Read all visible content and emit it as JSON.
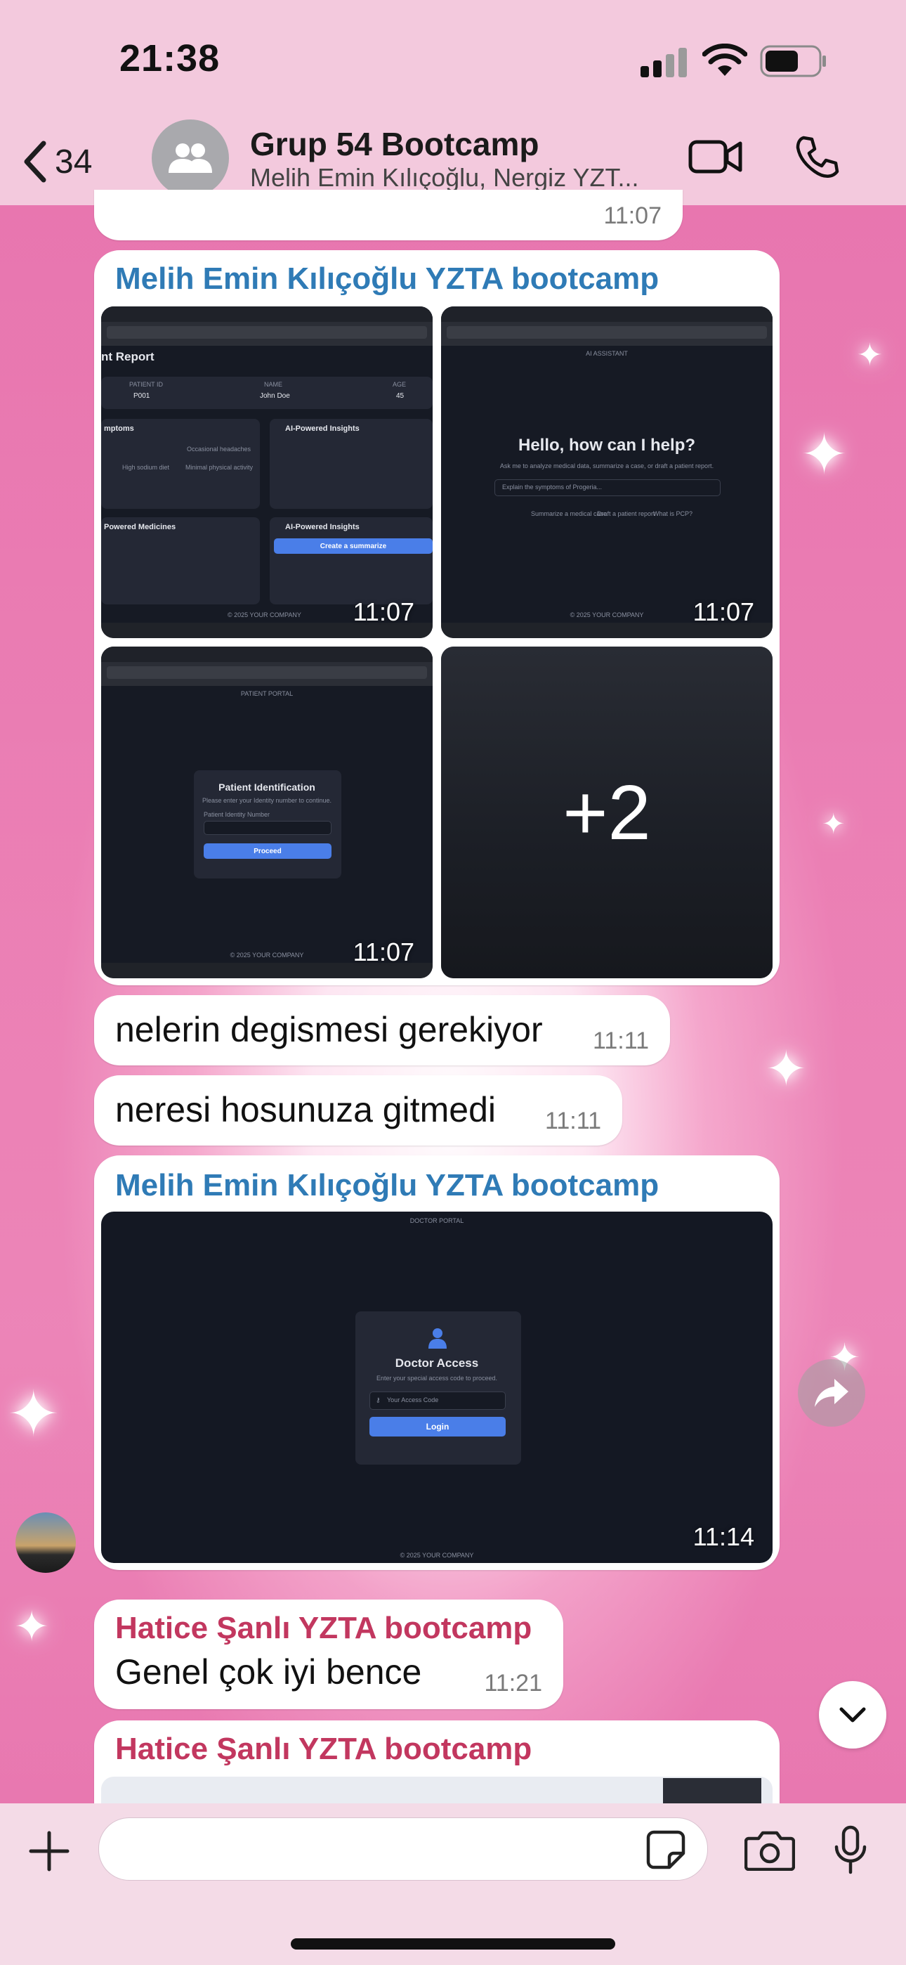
{
  "status_bar": {
    "time": "21:38"
  },
  "header": {
    "back_count": "34",
    "title": "Grup 54 Bootcamp",
    "subtitle": "Melih Emin Kılıçoğlu, Nergiz YZT..."
  },
  "messages": [
    {
      "time": "11:07"
    },
    {
      "sender": "Melih Emin Kılıçoğlu YZTA bootcamp",
      "sender_color": "#2f7bb6",
      "album": [
        {
          "time": "11:07",
          "title": "nt Report",
          "labels": [
            "PATIENT ID",
            "NAME",
            "AGE"
          ],
          "values": [
            "P001",
            "John Doe",
            "45"
          ],
          "sections": [
            "mptoms",
            "AI-Powered Insights",
            "Powered Medicines",
            "AI-Powered Insights"
          ],
          "tags": [
            "Occasional headaches",
            "High sodium diet",
            "Minimal physical activity"
          ],
          "button": "Create a summarize",
          "footer": "© 2025 YOUR COMPANY"
        },
        {
          "time": "11:07",
          "top": "AI ASSISTANT",
          "heading": "Hello, how can I help?",
          "sub": "Ask me to analyze medical data, summarize a case, or draft a patient report.",
          "placeholder": "Explain the symptoms of Progeria...",
          "chips": [
            "Summarize a medical case",
            "Draft a patient report",
            "What is PCP?"
          ],
          "footer": "© 2025 YOUR COMPANY"
        },
        {
          "time": "11:07",
          "top": "PATIENT PORTAL",
          "heading": "Patient Identification",
          "sub": "Please enter your Identity number to continue.",
          "field_label": "Patient Identity Number",
          "button": "Proceed",
          "footer": "© 2025 YOUR COMPANY"
        },
        {
          "more": "+2"
        }
      ]
    },
    {
      "text": "nelerin degismesi gerekiyor",
      "time": "11:11"
    },
    {
      "text": "neresi hosunuza gitmedi",
      "time": "11:11"
    },
    {
      "sender": "Melih Emin Kılıçoğlu YZTA bootcamp",
      "sender_color": "#2f7bb6",
      "image": {
        "top": "DOCTOR PORTAL",
        "heading": "Doctor Access",
        "sub": "Enter your special access code to proceed.",
        "placeholder": "Your Access Code",
        "button": "Login",
        "footer": "© 2025 YOUR COMPANY",
        "time": "11:14"
      }
    },
    {
      "sender": "Hatice Şanlı YZTA bootcamp",
      "sender_color": "#c2375f",
      "text": "Genel çok iyi bence",
      "time": "11:21"
    },
    {
      "sender": "Hatice Şanlı YZTA bootcamp",
      "sender_color": "#c2375f"
    }
  ],
  "icons": {
    "back": "chevron-left-icon",
    "group": "group-avatar-icon",
    "video": "video-call-icon",
    "call": "phone-icon",
    "forward": "forward-icon",
    "scroll": "chevron-down-icon",
    "attach": "plus-icon",
    "sticker": "sticker-icon",
    "camera": "camera-icon",
    "mic": "microphone-icon"
  },
  "colors": {
    "accent": "#2f7bb6",
    "sender2": "#c2375f",
    "button": "#4a7ee8"
  }
}
